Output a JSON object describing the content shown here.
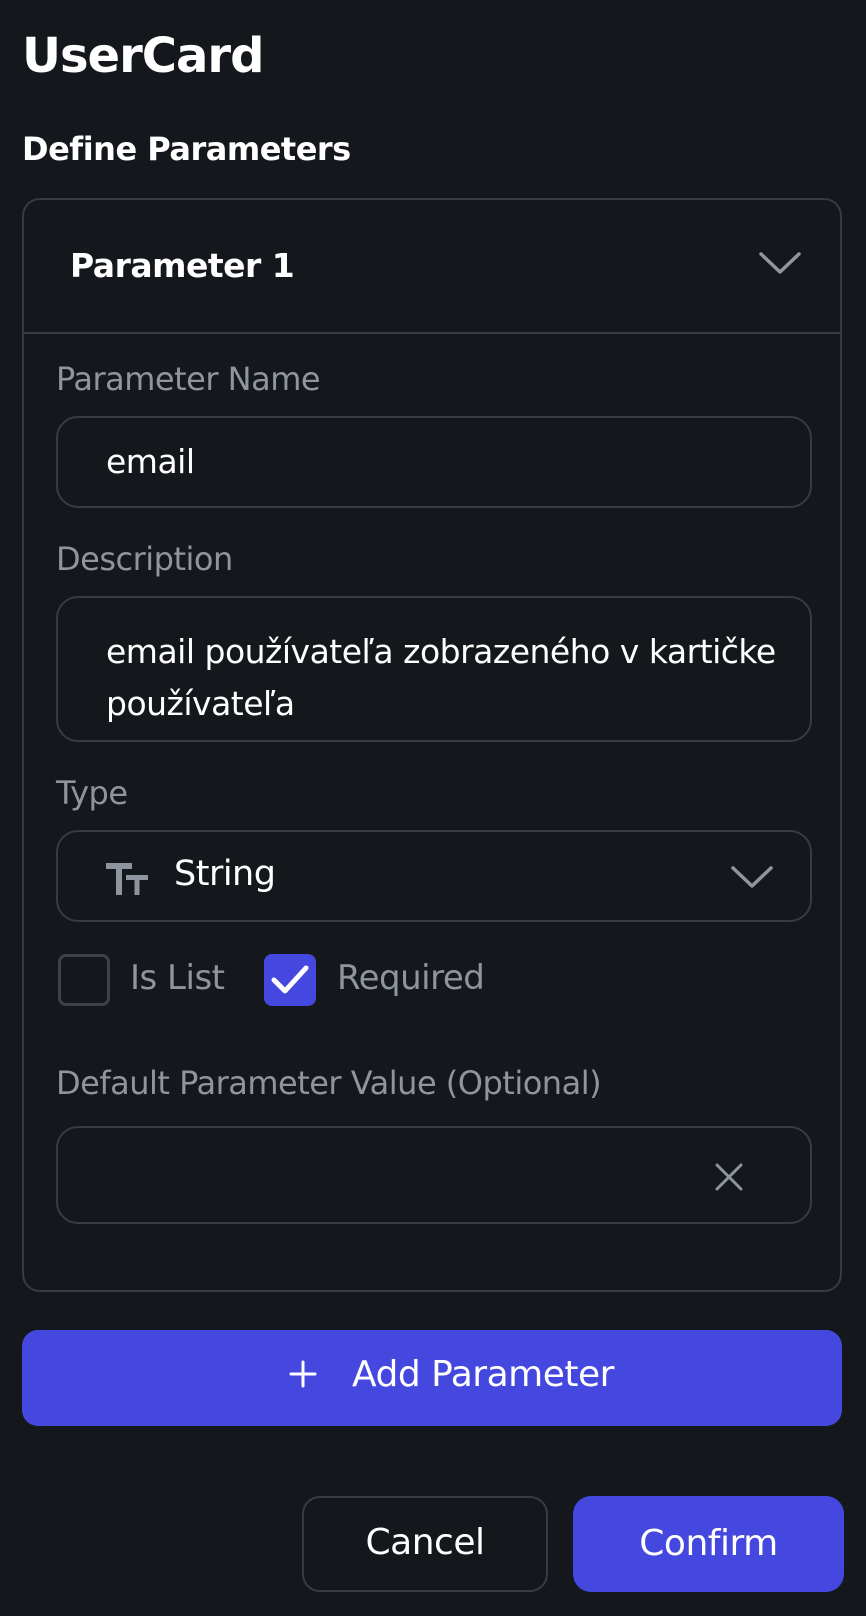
{
  "dialog": {
    "title": "UserCard",
    "subtitle": "Define Parameters"
  },
  "parameter": {
    "header_label": "Parameter 1",
    "expanded": true,
    "name_label": "Parameter Name",
    "name_value": "email",
    "description_label": "Description",
    "description_value": "email používateľa zobrazeného v kartičke používateľa",
    "type_label": "Type",
    "type_value": "String",
    "type_icon": "text-type-icon",
    "is_list_label": "Is List",
    "is_list_checked": false,
    "required_label": "Required",
    "required_checked": true,
    "default_label": "Default Parameter Value (Optional)",
    "default_value": ""
  },
  "actions": {
    "add_parameter_label": "Add Parameter",
    "cancel_label": "Cancel",
    "confirm_label": "Confirm"
  },
  "colors": {
    "background": "#14171b",
    "border": "#373c44",
    "accent": "#4548de",
    "muted_text": "#8f959e",
    "text": "#ffffff"
  }
}
